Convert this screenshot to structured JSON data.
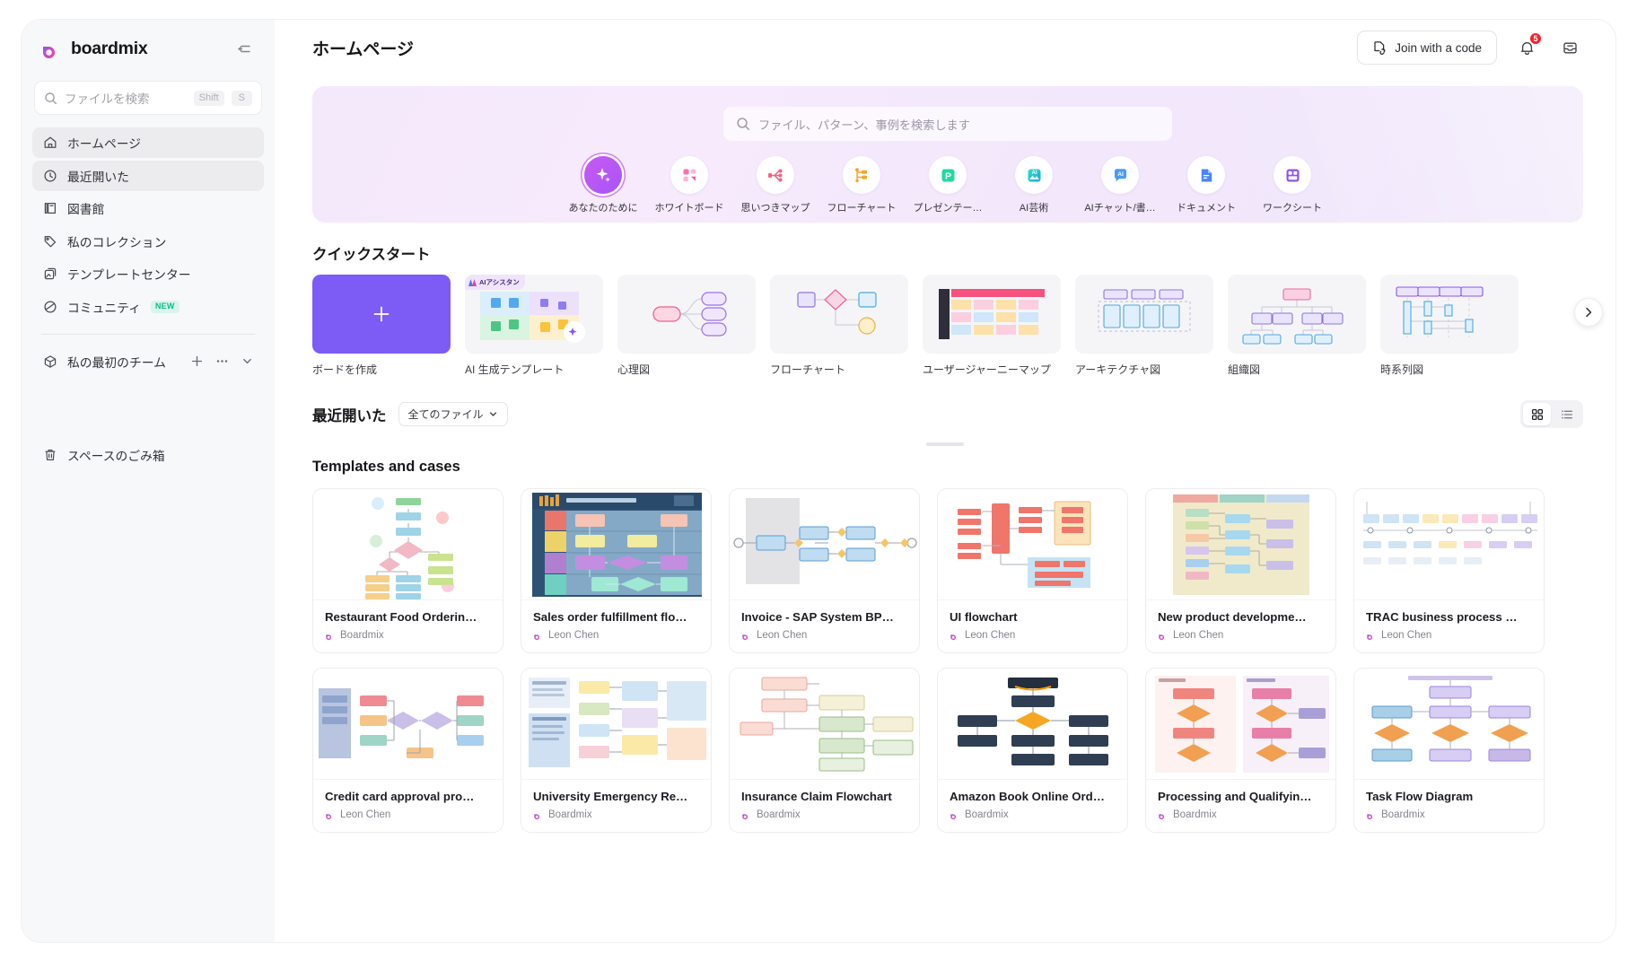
{
  "sidebar": {
    "brand": "boardmix",
    "collapse_icon": "collapse-panel-icon",
    "search": {
      "placeholder": "ファイルを検索",
      "key_shift": "Shift",
      "key_s": "S"
    },
    "items": [
      {
        "label": "ホームページ",
        "icon": "home-icon",
        "active": true
      },
      {
        "label": "最近開いた",
        "icon": "clock-icon",
        "active": true
      },
      {
        "label": "図書館",
        "icon": "library-icon",
        "active": false
      },
      {
        "label": "私のコレクション",
        "icon": "tag-icon",
        "active": false
      },
      {
        "label": "テンプレートセンター",
        "icon": "template-icon",
        "active": false
      },
      {
        "label": "コミュニティ",
        "icon": "community-icon",
        "active": false,
        "badge": "NEW"
      }
    ],
    "team": {
      "label": "私の最初のチーム",
      "icon": "cube-icon",
      "add": "+",
      "more": "···",
      "expand": "chevron-down-icon"
    },
    "trash": {
      "label": "スペースのごみ箱",
      "icon": "trash-icon"
    }
  },
  "header": {
    "title": "ホームページ",
    "join_button": "Join with a code",
    "notification_count": "5"
  },
  "hero": {
    "search_placeholder": "ファイル、パターン、事例を検索します",
    "categories": [
      {
        "label": "あなたのために",
        "icon": "sparkle-icon",
        "selected": true
      },
      {
        "label": "ホワイトボード",
        "icon": "whiteboard-icon",
        "selected": false
      },
      {
        "label": "思いつきマップ",
        "icon": "mindmap-icon",
        "selected": false
      },
      {
        "label": "フローチャート",
        "icon": "flowchart-icon",
        "selected": false
      },
      {
        "label": "プレゼンテー…",
        "icon": "presentation-icon",
        "selected": false
      },
      {
        "label": "AI芸術",
        "icon": "ai-art-icon",
        "selected": false
      },
      {
        "label": "AIチャット/書…",
        "icon": "ai-chat-icon",
        "selected": false
      },
      {
        "label": "ドキュメント",
        "icon": "document-icon",
        "selected": false
      },
      {
        "label": "ワークシート",
        "icon": "worksheet-icon",
        "selected": false
      }
    ]
  },
  "quick_start": {
    "title": "クイックスタート",
    "next_icon": "chevron-right-icon",
    "ai_tag": "AIアシスタン",
    "items": [
      {
        "label": "ボードを作成",
        "kind": "create"
      },
      {
        "label": "AI 生成テンプレート",
        "kind": "ai"
      },
      {
        "label": "心理図",
        "kind": "mind"
      },
      {
        "label": "フローチャート",
        "kind": "flow"
      },
      {
        "label": "ユーザージャーニーマップ",
        "kind": "journey"
      },
      {
        "label": "アーキテクチャ図",
        "kind": "arch"
      },
      {
        "label": "組織図",
        "kind": "org"
      },
      {
        "label": "時系列図",
        "kind": "seq"
      }
    ]
  },
  "recent": {
    "title": "最近開いた",
    "filter": "全てのファイル",
    "filter_icon": "chevron-down-icon",
    "view_grid": "grid-view-icon",
    "view_list": "list-view-icon"
  },
  "templates": {
    "title": "Templates and cases",
    "cards": [
      {
        "name": "Restaurant Food Orderin…",
        "author": "Boardmix",
        "kind": "t1"
      },
      {
        "name": "Sales order fulfillment flo…",
        "author": "Leon Chen",
        "kind": "t2"
      },
      {
        "name": "Invoice - SAP System BP…",
        "author": "Leon Chen",
        "kind": "t3"
      },
      {
        "name": "UI flowchart",
        "author": "Leon Chen",
        "kind": "t4"
      },
      {
        "name": "New product developme…",
        "author": "Leon Chen",
        "kind": "t5"
      },
      {
        "name": "TRAC business process …",
        "author": "Leon Chen",
        "kind": "t6"
      },
      {
        "name": "Credit card approval pro…",
        "author": "Leon Chen",
        "kind": "t7"
      },
      {
        "name": "University Emergency Re…",
        "author": "Boardmix",
        "kind": "t8"
      },
      {
        "name": "Insurance Claim Flowchart",
        "author": "Boardmix",
        "kind": "t9"
      },
      {
        "name": "Amazon Book Online Ord…",
        "author": "Boardmix",
        "kind": "t10"
      },
      {
        "name": "Processing and Qualifyin…",
        "author": "Boardmix",
        "kind": "t11"
      },
      {
        "name": "Task Flow Diagram",
        "author": "Boardmix",
        "kind": "t12"
      }
    ]
  },
  "colors": {
    "brand_purple": "#7c5cf5",
    "brand_pink": "#ff3b9a",
    "accent_violet": "#a855f7",
    "badge_red": "#f5222d",
    "new_green": "#10b98a"
  }
}
